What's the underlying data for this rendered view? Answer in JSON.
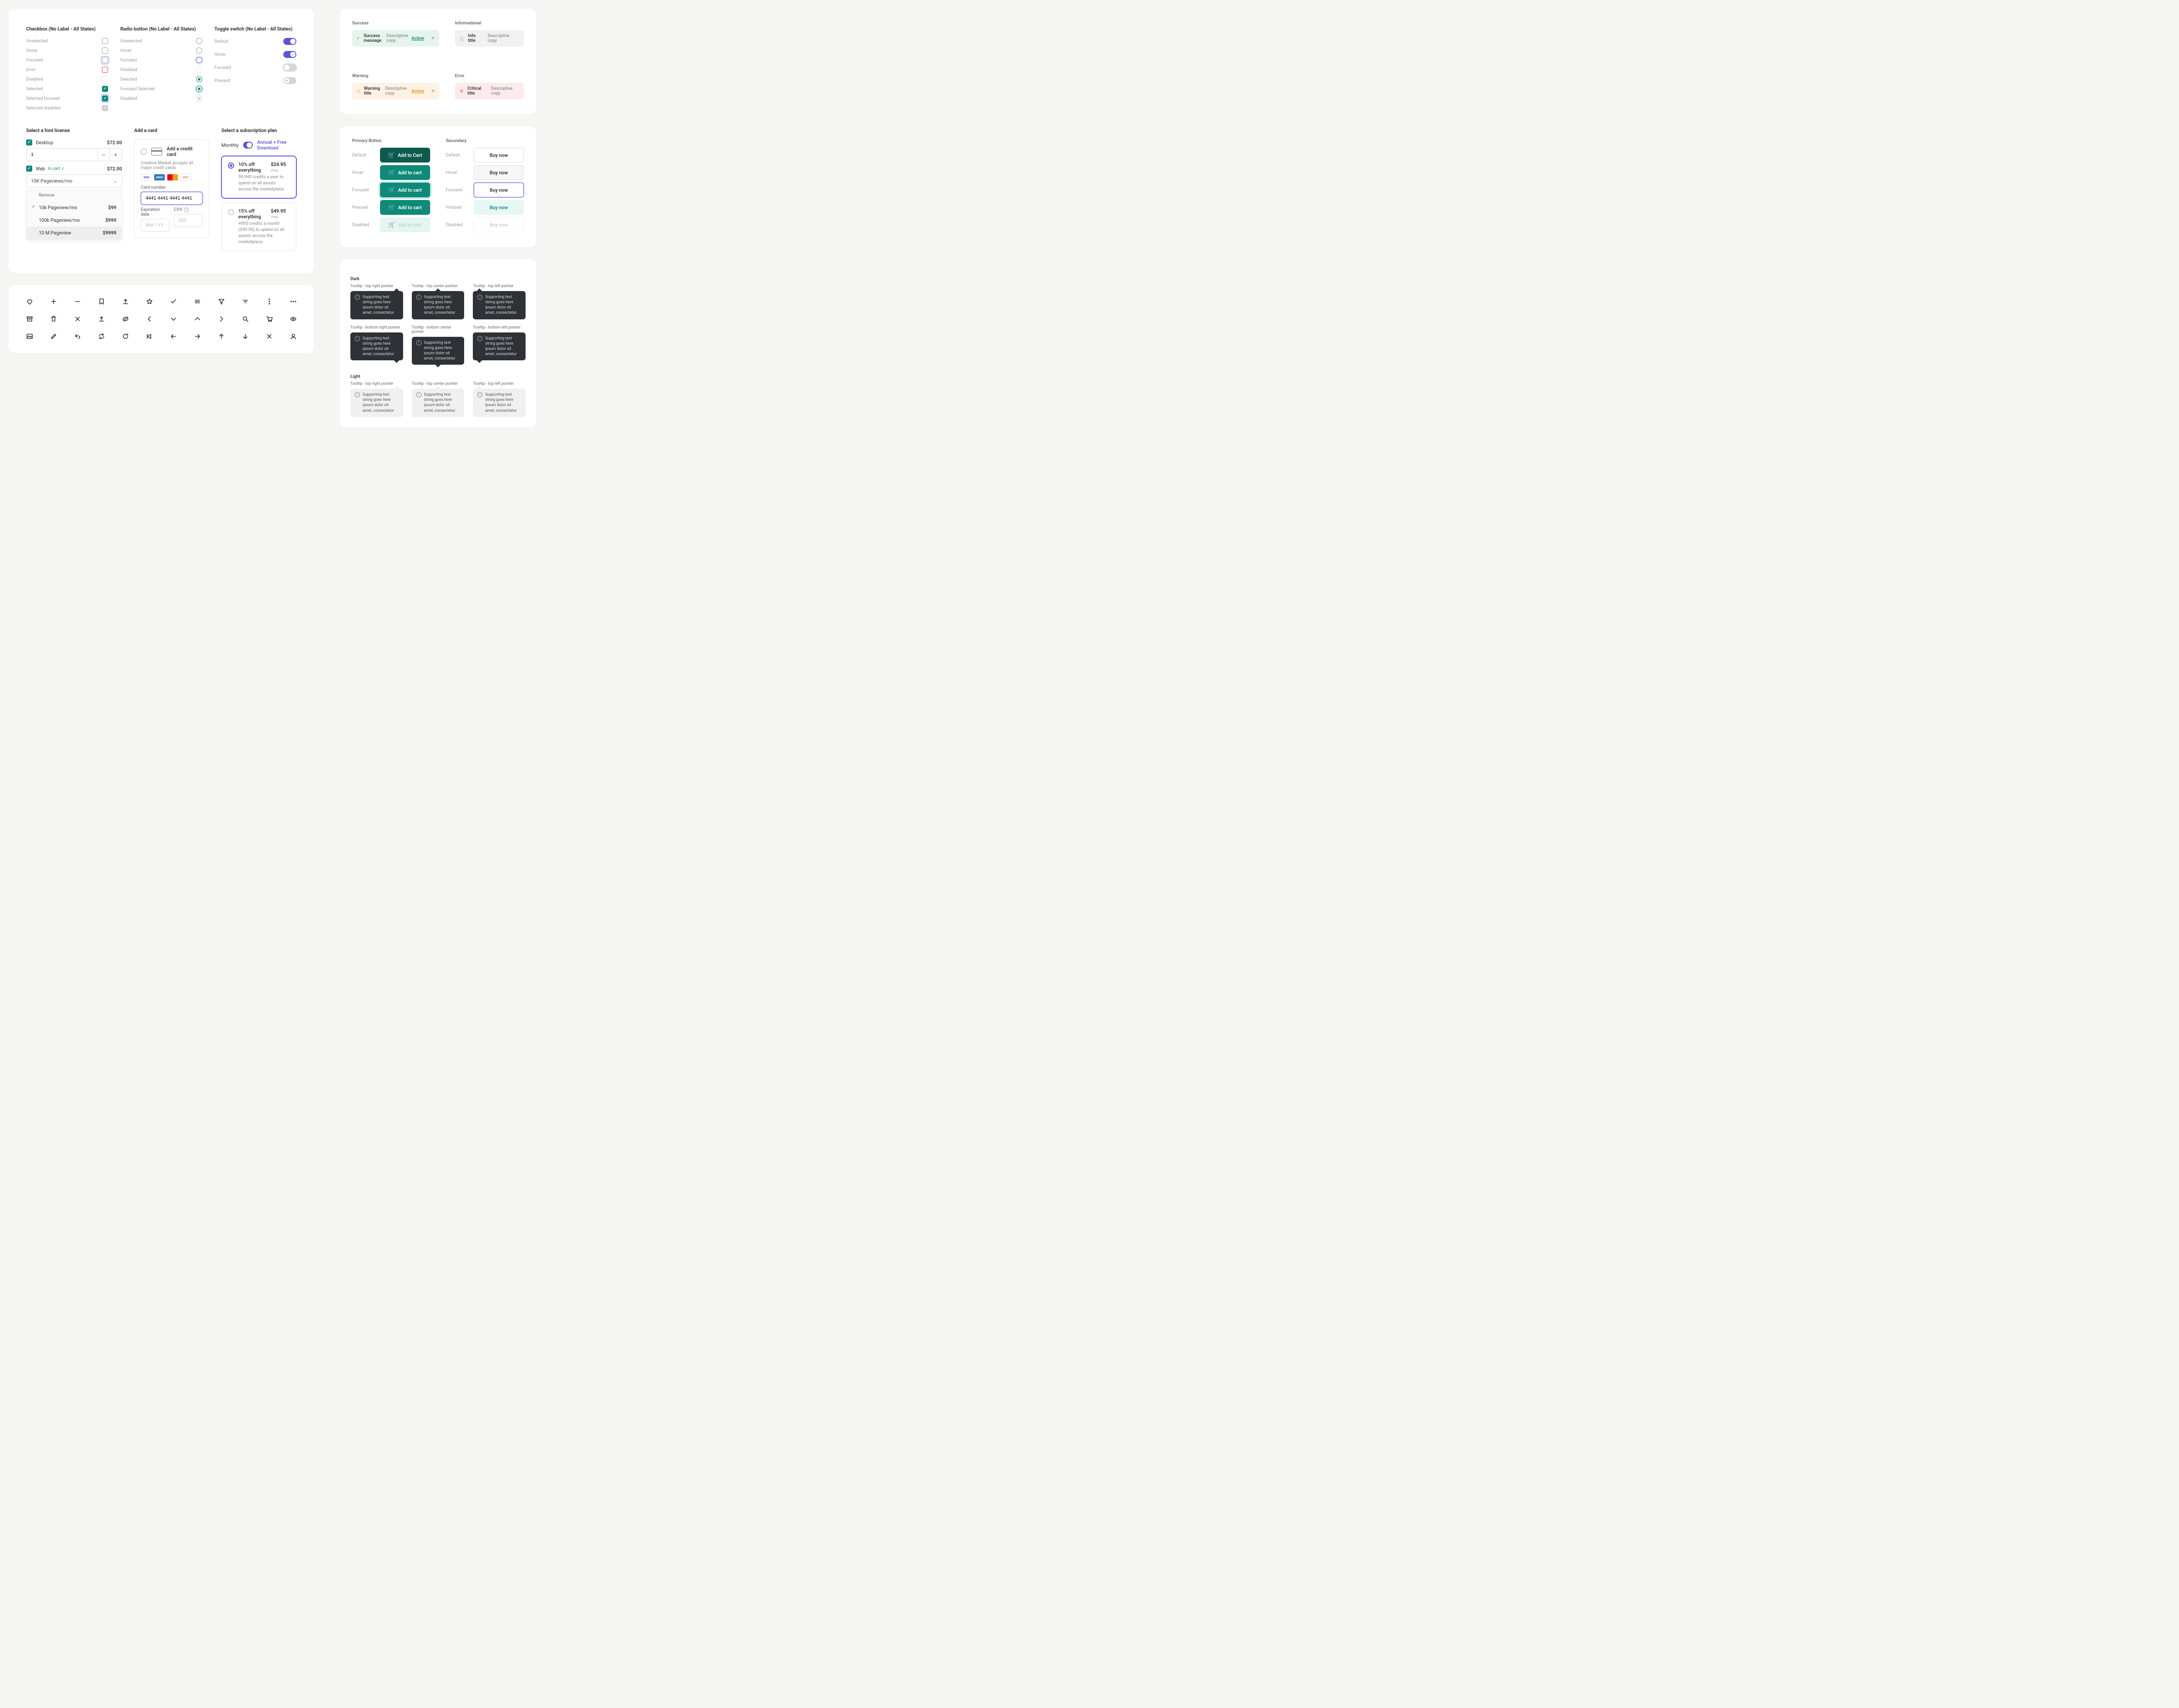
{
  "checkbox": {
    "heading": "Checkbox (No Label - All States)",
    "states": [
      "Unselected",
      "Hover",
      "Focused",
      "Error",
      "Disabled",
      "Selected",
      "Selected focused",
      "Selected disabled"
    ]
  },
  "radio": {
    "heading": "Radio button (No Label - All States)",
    "states": [
      "Unselected",
      "Hover",
      "Focused",
      "Disabled",
      "Selected",
      "Focused Selected",
      "Disabled"
    ]
  },
  "toggle": {
    "heading": "Toggle switch (No Label - All States)",
    "states": [
      "Default",
      "Hover",
      "Focused",
      "Pressed"
    ]
  },
  "license": {
    "heading": "Select a font license",
    "desktop": {
      "label": "Desktop",
      "price": "$72.00",
      "qty": "1"
    },
    "web": {
      "label": "Web",
      "in_cart": "In cart ✓",
      "price": "$72.00",
      "selected": "10K Pageviews/mo"
    },
    "dropdown": {
      "remove": "Remove",
      "items": [
        {
          "name": "10k Pageview/mo",
          "price": "$99",
          "checked": true
        },
        {
          "name": "100k Pageview/mo",
          "price": "$999"
        },
        {
          "name": "10 M Pageview",
          "price": "$9999"
        }
      ]
    }
  },
  "card_form": {
    "heading": "Add a card",
    "title": "Add a credit card",
    "subtitle": "Creative Market accepts all major credit cards",
    "card_number_label": "Card number",
    "card_number_value": "4441 4441 4441 4441",
    "exp_label": "Expiration date",
    "exp_placeholder": "MM / YY",
    "cvv_label": "CVV",
    "cvv_placeholder": "000"
  },
  "plans": {
    "heading": "Select a subscription plan",
    "monthly": "Monthly",
    "annual": "Annual + Free Download",
    "opts": [
      {
        "title": "10% off everything",
        "price": "$24.95",
        "per": "/mo",
        "desc": "59,940 credits a year to spend on all assets across the marketplace."
      },
      {
        "title": "15% off everything",
        "price": "$49.95",
        "per": "/mo",
        "desc": "4995 credits a month ($49.95) to spend on all assets across the marketplace."
      }
    ]
  },
  "alerts": {
    "success": {
      "heading": "Success",
      "title": "Success message",
      "desc": "Descriptive copy",
      "action": "Action"
    },
    "info": {
      "heading": "Informational",
      "title": "Info title",
      "desc": "Descriptive copy"
    },
    "warning": {
      "heading": "Warning",
      "title": "Warning title",
      "desc": "Descriptive copy",
      "action": "Action"
    },
    "error": {
      "heading": "Error",
      "title": "Critical title",
      "desc": "Descriptive copy"
    }
  },
  "buttons": {
    "primary_heading": "Primary Button",
    "secondary_heading": "Secondary",
    "states": [
      "Default",
      "Hover",
      "Focused",
      "Pressed",
      "Disabled"
    ],
    "primary_labels": [
      "Add to Cart",
      "Add to cart",
      "Add to cart",
      "Add to cart",
      "Add to cart"
    ],
    "secondary_labels": [
      "Buy now",
      "Buy now",
      "Buy now",
      "Buy now",
      "Buy now"
    ]
  },
  "tooltips": {
    "dark_heading": "Dark",
    "light_heading": "Light",
    "positions": [
      "Tooltip - top right pointer",
      "Tooltip - top center pointer",
      "Tooltip - top left pointer",
      "Tooltip - bottom right pointer",
      "Tooltip - bottom center pointer",
      "Tooltip - bottom left pointer"
    ],
    "copy": "Supporting text string goes here ipsum dolor sit amet, consectetur"
  }
}
